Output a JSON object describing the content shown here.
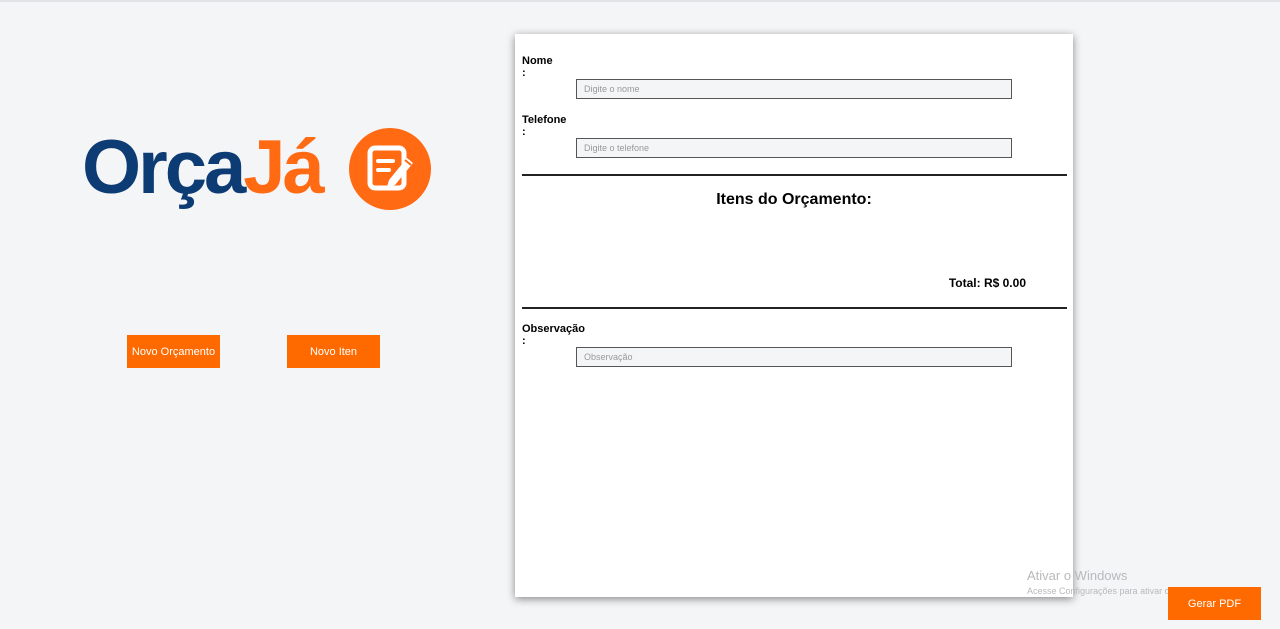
{
  "logo": {
    "text_part1": "Orça",
    "text_part2": "Já",
    "badge_icon": "edit-note-icon",
    "colors": {
      "primary": "#0d3b73",
      "accent": "#ff6a13"
    }
  },
  "actions": {
    "novo_orcamento": "Novo Orçamento",
    "novo_item": "Novo Iten",
    "gerar_pdf": "Gerar PDF"
  },
  "form": {
    "nome": {
      "label": "Nome",
      "colon": ":",
      "placeholder": "Digite o nome",
      "value": ""
    },
    "telefone": {
      "label": "Telefone",
      "colon": ":",
      "placeholder": "Digite o telefone",
      "value": ""
    },
    "observacao": {
      "label": "Observação",
      "colon": ":",
      "placeholder": "Observação",
      "value": ""
    }
  },
  "items": {
    "title": "Itens do Orçamento:",
    "total": "Total: R$ 0.00"
  },
  "watermark": {
    "title": "Ativar o Windows",
    "subtitle": "Acesse Configurações para ativar o Windows."
  },
  "theme": {
    "button_color": "#ff6a00",
    "background": "#f4f5f7"
  }
}
